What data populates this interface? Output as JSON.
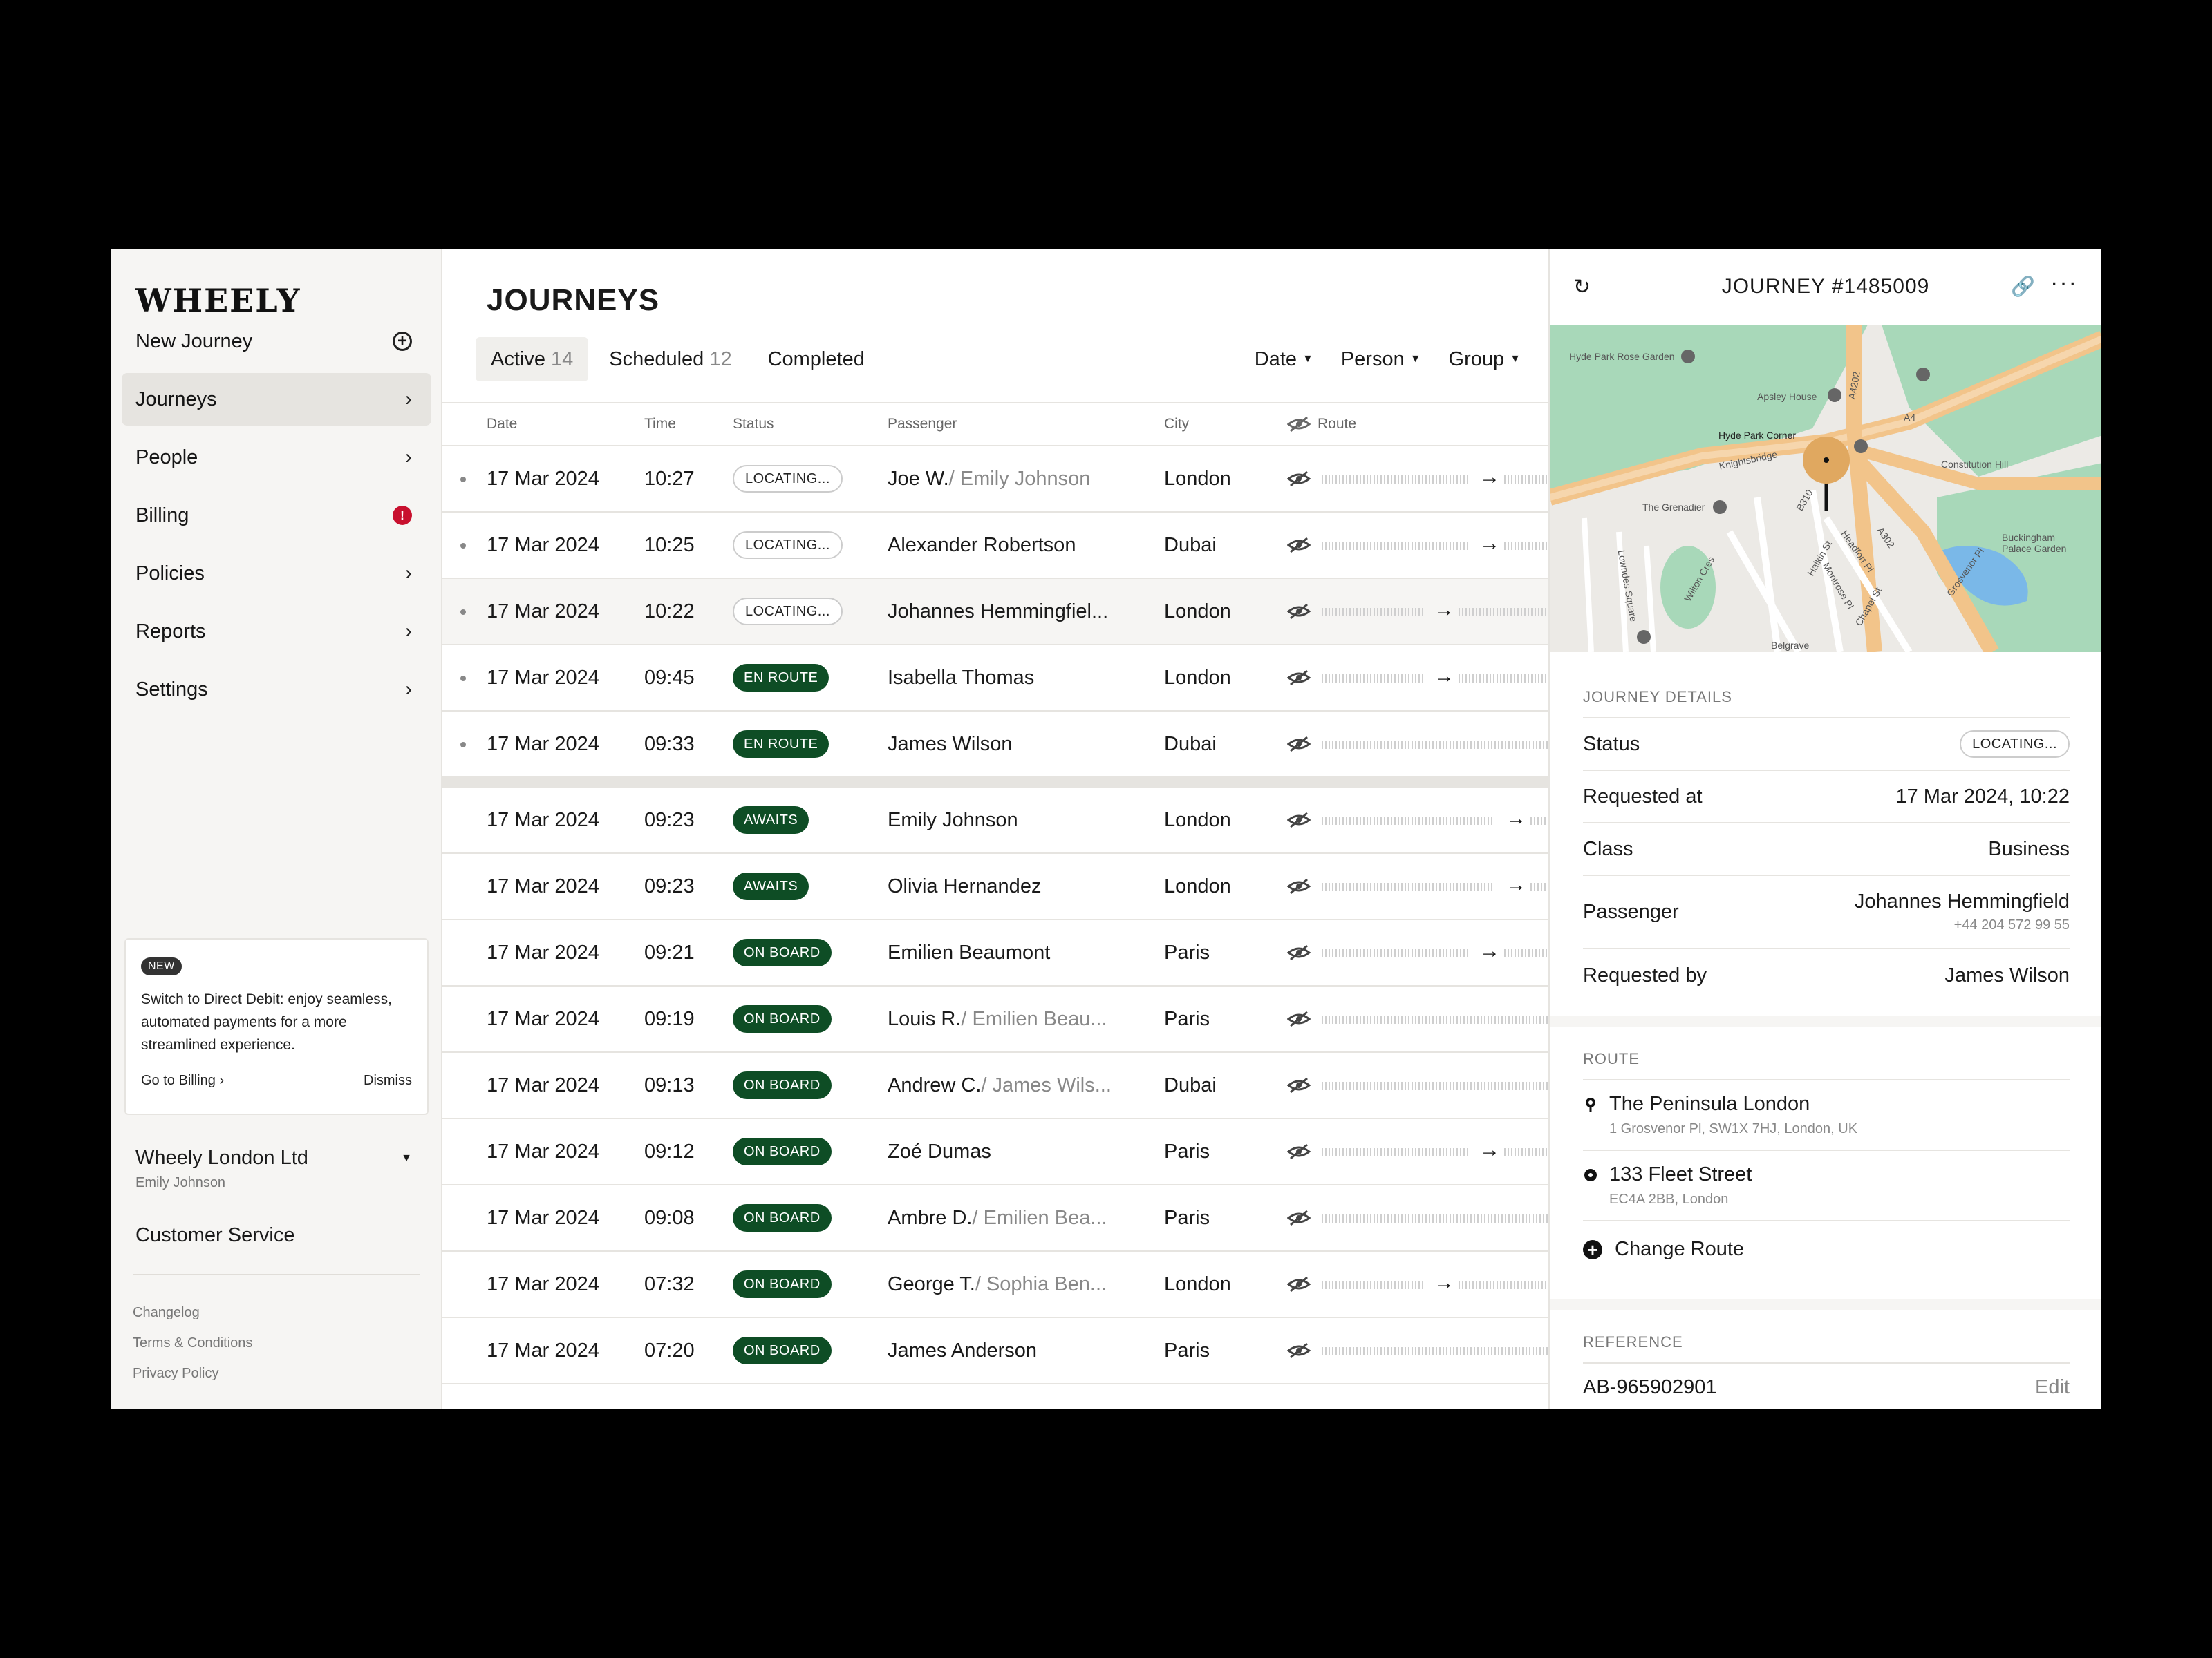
{
  "app": {
    "logo": "WHEELY"
  },
  "sidebar": {
    "items": [
      {
        "label": "New Journey",
        "icon": "plus-circle-icon"
      },
      {
        "label": "Journeys",
        "icon": "chevron-right-icon",
        "active": true
      },
      {
        "label": "People",
        "icon": "chevron-right-icon"
      },
      {
        "label": "Billing",
        "icon": "alert-icon"
      },
      {
        "label": "Policies",
        "icon": "chevron-right-icon"
      },
      {
        "label": "Reports",
        "icon": "chevron-right-icon"
      },
      {
        "label": "Settings",
        "icon": "chevron-right-icon"
      }
    ],
    "promo": {
      "badge": "NEW",
      "text": "Switch to Direct Debit: enjoy seamless, automated payments for a more streamlined experience.",
      "action": "Go to Billing ›",
      "dismiss": "Dismiss"
    },
    "company": {
      "name": "Wheely London Ltd",
      "user": "Emily Johnson"
    },
    "customer_service": "Customer Service",
    "footer_links": [
      "Changelog",
      "Terms & Conditions",
      "Privacy Policy"
    ]
  },
  "main": {
    "title": "JOURNEYS",
    "tabs": [
      {
        "label": "Active",
        "count": "14",
        "active": true
      },
      {
        "label": "Scheduled",
        "count": "12"
      },
      {
        "label": "Completed",
        "count": ""
      }
    ],
    "filters": [
      "Date",
      "Person",
      "Group"
    ],
    "columns": [
      "Date",
      "Time",
      "Status",
      "Passenger",
      "City",
      "Route"
    ],
    "rows": [
      {
        "date": "17 Mar 2024",
        "time": "10:27",
        "status": "LOCATING...",
        "kind": "locating",
        "passenger": "Joe W.",
        "secondary": " / Emily Johnson",
        "city": "London",
        "dot": true,
        "arrow": "right-long"
      },
      {
        "date": "17 Mar 2024",
        "time": "10:25",
        "status": "LOCATING...",
        "kind": "locating",
        "passenger": "Alexander Robertson",
        "secondary": "",
        "city": "Dubai",
        "dot": true,
        "arrow": "right-long"
      },
      {
        "date": "17 Mar 2024",
        "time": "10:22",
        "status": "LOCATING...",
        "kind": "locating",
        "passenger": "Johannes Hemmingfiel...",
        "secondary": "",
        "city": "London",
        "dot": true,
        "arrow": "right-short",
        "selected": true
      },
      {
        "date": "17 Mar 2024",
        "time": "09:45",
        "status": "EN ROUTE",
        "kind": "dark",
        "passenger": "Isabella Thomas",
        "secondary": "",
        "city": "London",
        "dot": true,
        "arrow": "right-short"
      },
      {
        "date": "17 Mar 2024",
        "time": "09:33",
        "status": "EN ROUTE",
        "kind": "dark",
        "passenger": "James Wilson",
        "secondary": "",
        "city": "Dubai",
        "dot": true,
        "arrow": "none"
      },
      {
        "date": "17 Mar 2024",
        "time": "09:23",
        "status": "AWAITS",
        "kind": "dark",
        "passenger": "Emily Johnson",
        "secondary": "",
        "city": "London",
        "dot": false,
        "arrow": "right-far",
        "gap": true
      },
      {
        "date": "17 Mar 2024",
        "time": "09:23",
        "status": "AWAITS",
        "kind": "dark",
        "passenger": "Olivia Hernandez",
        "secondary": "",
        "city": "London",
        "dot": false,
        "arrow": "right-far"
      },
      {
        "date": "17 Mar 2024",
        "time": "09:21",
        "status": "ON BOARD",
        "kind": "dark",
        "passenger": "Emilien Beaumont",
        "secondary": "",
        "city": "Paris",
        "dot": false,
        "arrow": "right-long"
      },
      {
        "date": "17 Mar 2024",
        "time": "09:19",
        "status": "ON BOARD",
        "kind": "dark",
        "passenger": "Louis R.",
        "secondary": " / Emilien Beau...",
        "city": "Paris",
        "dot": false,
        "arrow": "none"
      },
      {
        "date": "17 Mar 2024",
        "time": "09:13",
        "status": "ON BOARD",
        "kind": "dark",
        "passenger": "Andrew C.",
        "secondary": " / James Wils...",
        "city": "Dubai",
        "dot": false,
        "arrow": "none"
      },
      {
        "date": "17 Mar 2024",
        "time": "09:12",
        "status": "ON BOARD",
        "kind": "dark",
        "passenger": "Zoé Dumas",
        "secondary": "",
        "city": "Paris",
        "dot": false,
        "arrow": "right-long"
      },
      {
        "date": "17 Mar 2024",
        "time": "09:08",
        "status": "ON BOARD",
        "kind": "dark",
        "passenger": "Ambre D.",
        "secondary": " / Emilien Bea...",
        "city": "Paris",
        "dot": false,
        "arrow": "none"
      },
      {
        "date": "17 Mar 2024",
        "time": "07:32",
        "status": "ON BOARD",
        "kind": "dark",
        "passenger": "George T.",
        "secondary": " / Sophia Ben...",
        "city": "London",
        "dot": false,
        "arrow": "right-short"
      },
      {
        "date": "17 Mar 2024",
        "time": "07:20",
        "status": "ON BOARD",
        "kind": "dark",
        "passenger": "James Anderson",
        "secondary": "",
        "city": "Paris",
        "dot": false,
        "arrow": "none"
      }
    ]
  },
  "panel": {
    "title": "JOURNEY #1485009",
    "map_labels": [
      "Hyde Park Rose Garden",
      "Apsley House",
      "Hyde Park Corner",
      "Knightsbridge",
      "Constitution Hill",
      "The Grenadier",
      "Buckingham Palace Garden",
      "Grosvenor Pl",
      "Belgrave",
      "A4",
      "A4202",
      "A302",
      "B310",
      "Halkin St",
      "Headfort Pl",
      "Montrose Pl",
      "Chapel St",
      "Wilton Cres",
      "Lowndes Square"
    ],
    "details_title": "JOURNEY DETAILS",
    "details": [
      {
        "label": "Status",
        "value": "LOCATING...",
        "pill": true
      },
      {
        "label": "Requested at",
        "value": "17 Mar 2024, 10:22"
      },
      {
        "label": "Class",
        "value": "Business"
      },
      {
        "label": "Passenger",
        "value": "Johannes Hemmingfield",
        "sub": "+44 204 572 99 55"
      },
      {
        "label": "Requested by",
        "value": "James Wilson"
      }
    ],
    "route_title": "ROUTE",
    "route": [
      {
        "title": "The Peninsula London",
        "sub": "1 Grosvenor Pl, SW1X 7HJ, London, UK",
        "icon": "pin-icon"
      },
      {
        "title": "133 Fleet Street",
        "sub": "EC4A 2BB, London",
        "icon": "destination-dot-icon"
      }
    ],
    "change_route": "Change Route",
    "reference_title": "REFERENCE",
    "reference_value": "AB-965902901",
    "reference_edit": "Edit"
  },
  "colors": {
    "status_dark": "#0e4d25",
    "alert": "#c8102e",
    "marker": "#e0a860",
    "park": "#a8d8b9"
  }
}
